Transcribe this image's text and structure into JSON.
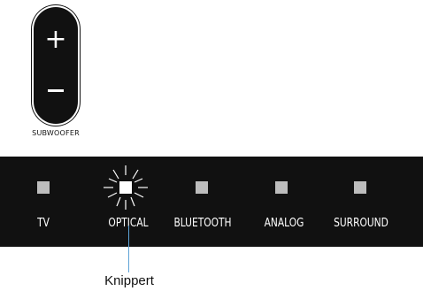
{
  "subwoofer": {
    "plus_symbol": "+",
    "minus_symbol": "–",
    "caption": "SUBWOOFER"
  },
  "inputs": [
    {
      "label": "TV",
      "state": "off"
    },
    {
      "label": "OPTICAL",
      "state": "blinking"
    },
    {
      "label": "BLUETOOTH",
      "state": "off"
    },
    {
      "label": "ANALOG",
      "state": "off"
    },
    {
      "label": "SURROUND",
      "state": "off"
    }
  ],
  "callout": {
    "text": "Knippert"
  },
  "colors": {
    "panel": "#111111",
    "led_off": "#bdbdbd",
    "led_on": "#ffffff",
    "callout_line": "#5ea3d6"
  }
}
